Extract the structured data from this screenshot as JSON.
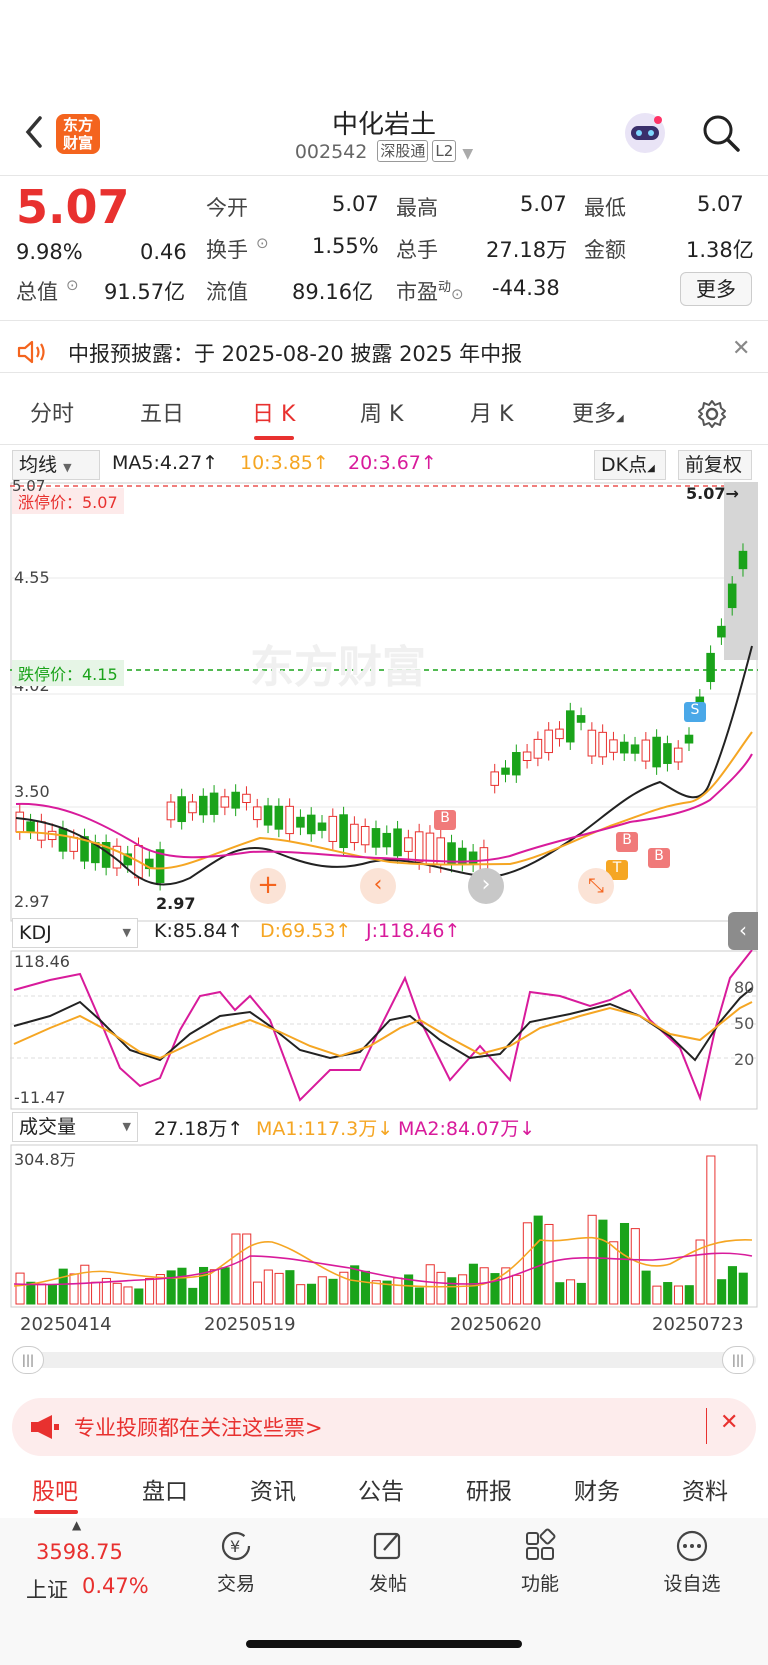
{
  "header": {
    "logo_text": "东方财富",
    "stock_name": "中化岩土",
    "stock_code": "002542",
    "tag1": "深股通",
    "tag2": "L2"
  },
  "quote": {
    "price": "5.07",
    "change_pct": "9.98%",
    "change": "0.46",
    "open_label": "今开",
    "open": "5.07",
    "high_label": "最高",
    "high": "5.07",
    "low_label": "最低",
    "low": "5.07",
    "turnover_label": "换手",
    "turnover": "1.55%",
    "volume_label": "总手",
    "volume": "27.18万",
    "amount_label": "金额",
    "amount": "1.38亿",
    "mktcap_label": "总值",
    "mktcap": "91.57亿",
    "float_label": "流值",
    "float": "89.16亿",
    "pe_label": "市盈",
    "pe_sup": "动",
    "pe": "-44.38",
    "more_label": "更多"
  },
  "notice": {
    "text": "中报预披露：于 2025-08-20 披露 2025 年中报"
  },
  "tabs": [
    "分时",
    "五日",
    "日 K",
    "周 K",
    "月 K",
    "更多"
  ],
  "toolbar": {
    "ma_select": "均线",
    "ma5": "MA5:4.27↑",
    "ma10": "10:3.85↑",
    "ma20": "20:3.67↑",
    "dk": "DK点",
    "adjust": "前复权"
  },
  "kline": {
    "limit_up_label": "涨停价：5.07",
    "limit_down_label": "跌停价：4.15",
    "y_top": "5.07",
    "y1": "4.55",
    "y2": "4.02",
    "y3": "3.50",
    "y_bottom": "2.97",
    "last_label": "5.07→",
    "low_label": "2.97",
    "watermark": "东方财富"
  },
  "kdj": {
    "select": "KDJ",
    "k": "K:85.84↑",
    "d": "D:69.53↑",
    "j": "J:118.46↑",
    "y_top": "118.46",
    "y_bottom": "-11.47",
    "r80": "80",
    "r50": "50",
    "r20": "20"
  },
  "vol": {
    "select": "成交量",
    "value": "27.18万↑",
    "ma1": "MA1:117.3万↓",
    "ma2": "MA2:84.07万↓",
    "y_top": "304.8万",
    "dates": [
      "20250414",
      "20250519",
      "20250620",
      "20250723"
    ]
  },
  "banner": {
    "text": "专业投顾都在关注这些票>"
  },
  "bottom_tabs": [
    "股吧",
    "盘口",
    "资讯",
    "公告",
    "研报",
    "财务",
    "资料"
  ],
  "bottom_bar": {
    "index_value": "3598.75",
    "index_name": "上证",
    "index_change": "0.47%",
    "trade": "交易",
    "post": "发帖",
    "function": "功能",
    "watchlist": "设自选"
  },
  "colors": {
    "up": "#e8312f",
    "down": "#1aa31a",
    "ma5": "#222222",
    "ma10": "#f5a623",
    "ma20": "#d81b9b",
    "accent": "#f4641e"
  }
}
